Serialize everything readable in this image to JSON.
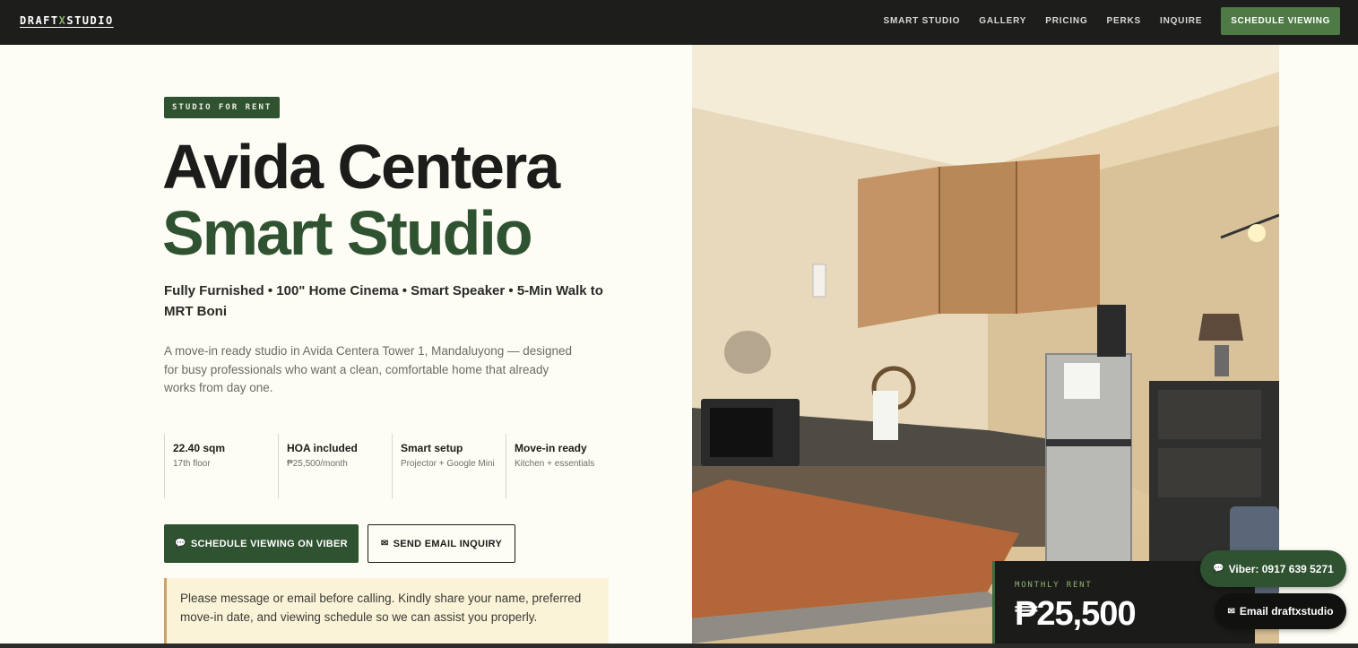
{
  "nav": {
    "logo_left": "DRAFT",
    "logo_x": "X",
    "logo_right": "STUDIO",
    "links": [
      "SMART STUDIO",
      "GALLERY",
      "PRICING",
      "PERKS",
      "INQUIRE"
    ],
    "cta": "SCHEDULE VIEWING"
  },
  "hero": {
    "badge": "STUDIO FOR RENT",
    "title_line1": "Avida Centera",
    "title_line2": "Smart Studio",
    "features": "Fully Furnished • 100\" Home Cinema • Smart Speaker • 5-Min Walk to MRT Boni",
    "description": "A move-in ready studio in Avida Centera Tower 1, Mandaluyong — designed for busy professionals who want a clean, comfortable home that already works from day one.",
    "stats": [
      {
        "title": "22.40 sqm",
        "sub": "17th floor"
      },
      {
        "title": "HOA included",
        "sub": "₱25,500/month"
      },
      {
        "title": "Smart setup",
        "sub": "Projector + Google Mini"
      },
      {
        "title": "Move-in ready",
        "sub": "Kitchen + essentials"
      }
    ],
    "btn_viber": "SCHEDULE VIEWING ON VIBER",
    "btn_email": "SEND EMAIL INQUIRY",
    "notice": "Please message or email before calling. Kindly share your name, preferred move-in date, and viewing schedule so we can assist you properly."
  },
  "rent": {
    "label": "MONTHLY RENT",
    "price": "₱25,500"
  },
  "floating": {
    "viber": "Viber: 0917 639 5271",
    "email": "Email draftxstudio"
  },
  "icons": {
    "chat": "chat-bubble-icon",
    "mail": "mail-icon"
  }
}
